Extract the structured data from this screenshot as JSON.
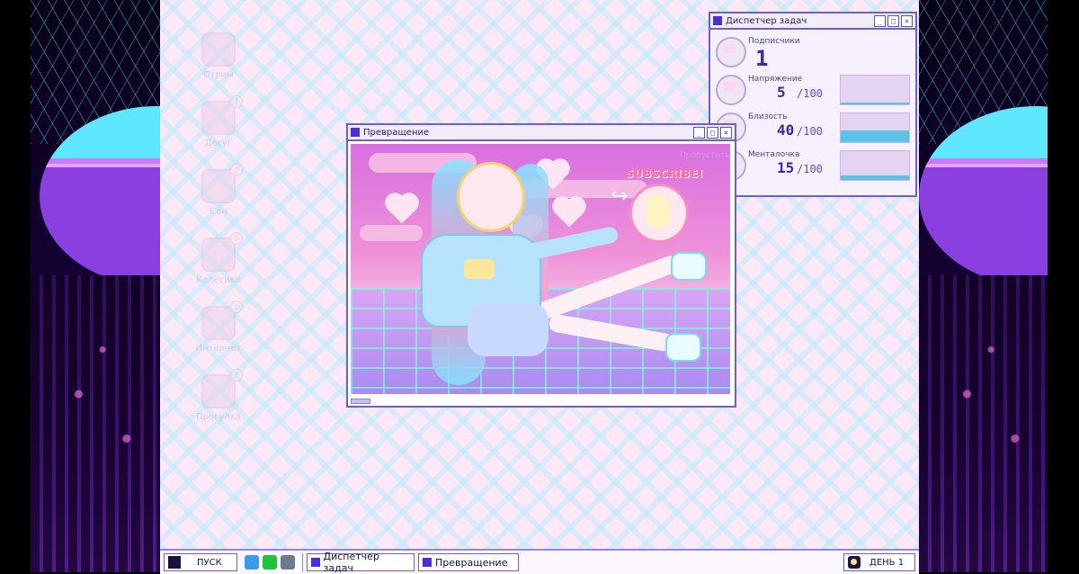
{
  "desktop_icons": [
    {
      "label": "Стрим",
      "icon": "stream-icon"
    },
    {
      "label": "Досуг",
      "icon": "leisure-icon"
    },
    {
      "label": "Сон",
      "icon": "sleep-icon"
    },
    {
      "label": "Колёсики",
      "icon": "pills-icon"
    },
    {
      "label": "Интернет",
      "icon": "internet-icon"
    },
    {
      "label": "Прогулка",
      "icon": "walk-icon"
    }
  ],
  "task_manager": {
    "title": "Диспетчер задач",
    "subscribers": {
      "label": "Подписчики",
      "value": "1"
    },
    "stats": [
      {
        "label": "Напряжение",
        "value": "5",
        "max": "/100",
        "fraction": 0.05
      },
      {
        "label": "Близость",
        "value": "40",
        "max": "/100",
        "fraction": 0.4
      },
      {
        "label": "Менталочка",
        "value": "15",
        "max": "/100",
        "fraction": 0.15
      }
    ]
  },
  "transform_window": {
    "title": "Превращение",
    "skip_label": "Пропустить",
    "subscribe_text": "SUBSCRIBE!"
  },
  "window_buttons": {
    "minimize": "_",
    "maximize": "□",
    "close": "×"
  },
  "taskbar": {
    "start_label": "ПУСК",
    "quick_icons": [
      "twitter-icon",
      "line-icon",
      "monitor-icon"
    ],
    "tasks": [
      "Диспетчер задач",
      "Превращение"
    ],
    "day_label": "ДЕНЬ 1"
  },
  "colors": {
    "accent": "#6b5fd6",
    "title_square": "#4a2ed6",
    "meter_fill": "#5cc2e6"
  }
}
